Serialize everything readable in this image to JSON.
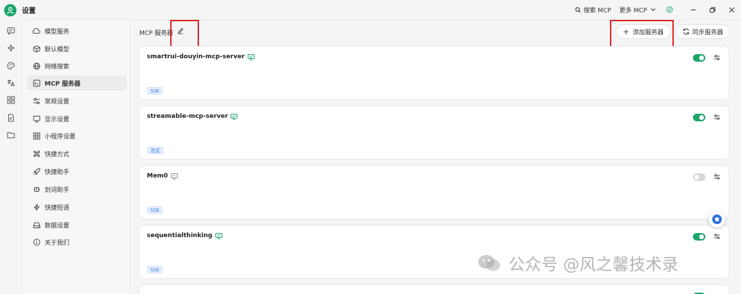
{
  "app": {
    "title": "设置"
  },
  "titlebar": {
    "search_mcp": "搜索 MCP",
    "more_mcp": "更多 MCP"
  },
  "nav": {
    "items": [
      {
        "label": "模型服务",
        "icon": "cloud-icon"
      },
      {
        "label": "默认模型",
        "icon": "cube-icon"
      },
      {
        "label": "网络搜索",
        "icon": "globe-icon"
      },
      {
        "label": "MCP 服务器",
        "icon": "server-icon",
        "active": true
      },
      {
        "label": "常规设置",
        "icon": "sliders-icon"
      },
      {
        "label": "显示设置",
        "icon": "monitor-icon"
      },
      {
        "label": "小程序设置",
        "icon": "grid-icon"
      },
      {
        "label": "快捷方式",
        "icon": "command-icon"
      },
      {
        "label": "快捷助手",
        "icon": "rocket-icon"
      },
      {
        "label": "划词助手",
        "icon": "text-select-icon"
      },
      {
        "label": "快捷短语",
        "icon": "zap-icon"
      },
      {
        "label": "数据设置",
        "icon": "drive-icon"
      },
      {
        "label": "关于我们",
        "icon": "info-icon"
      }
    ]
  },
  "main": {
    "title": "MCP 服务器",
    "add_server": "添加服务器",
    "sync_servers": "同步服务器",
    "servers": [
      {
        "name": "smartrui-douyin-mcp-server",
        "badge": "SSE",
        "enabled": true
      },
      {
        "name": "streamable-mcp-server",
        "badge": "流式",
        "enabled": true
      },
      {
        "name": "Mem0",
        "badge": "SSE",
        "enabled": false
      },
      {
        "name": "sequentialthinking",
        "badge": "SSE",
        "enabled": true
      },
      {
        "name": "",
        "badge": "",
        "enabled": true
      }
    ]
  },
  "watermark": {
    "text": "公众号 @风之馨技术录"
  },
  "colors": {
    "accent": "#1aa56b",
    "highlight_box": "#e02020",
    "badge_text": "#3b7be0"
  }
}
